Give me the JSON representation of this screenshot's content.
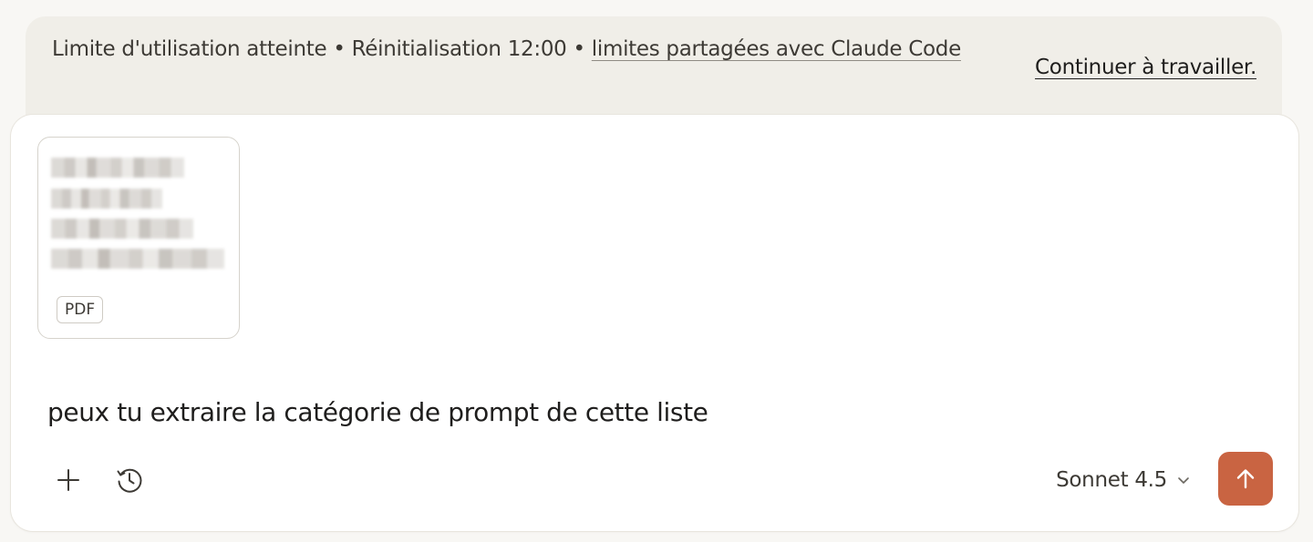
{
  "banner": {
    "status_text": "Limite d'utilisation atteinte • Réinitialisation 12:00 • ",
    "link_text": "limites partagées avec Claude Code",
    "continue_label": "Continuer à travailler."
  },
  "attachment": {
    "type_badge": "PDF",
    "icon": "blurred-document-preview"
  },
  "composer": {
    "message": "peux tu extraire la catégorie de prompt de cette liste",
    "add_icon": "plus-icon",
    "history_icon": "clock-history-icon",
    "model_label": "Sonnet 4.5",
    "model_icon": "chevron-down-icon",
    "send_icon": "arrow-up-icon"
  },
  "colors": {
    "accent": "#c96442",
    "banner_bg": "#f0eee8",
    "page_bg": "#f8f7f4"
  }
}
